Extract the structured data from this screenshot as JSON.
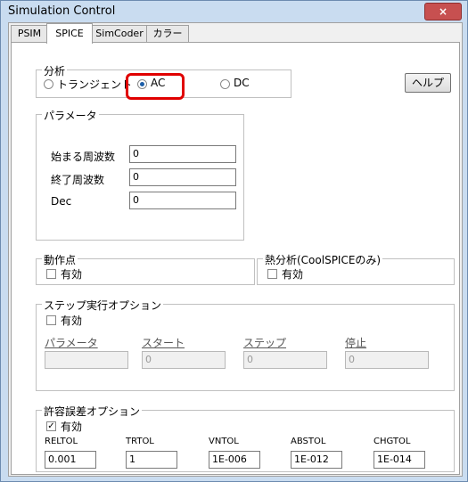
{
  "window": {
    "title": "Simulation Control",
    "close_glyph": "×"
  },
  "tabs": [
    "PSIM",
    "SPICE",
    "SimCoder",
    "カラー"
  ],
  "analysis": {
    "legend": "分析",
    "options": [
      "トランジェント",
      "AC",
      "DC"
    ],
    "selected": "AC",
    "help_label": "ヘルプ"
  },
  "params": {
    "legend": "パラメータ",
    "fields": [
      {
        "label": "始まる周波数",
        "value": "0"
      },
      {
        "label": "終了周波数",
        "value": "0"
      },
      {
        "label": "Dec",
        "value": "0"
      }
    ]
  },
  "operating_point": {
    "legend": "動作点",
    "checkbox_label": "有効",
    "checked": false
  },
  "thermal": {
    "legend": "熱分析(CoolSPICEのみ)",
    "checkbox_label": "有効",
    "checked": false
  },
  "step": {
    "legend": "ステップ実行オプション",
    "checkbox_label": "有効",
    "checked": false,
    "columns": [
      {
        "label": "パラメータ",
        "value": ""
      },
      {
        "label": "スタート",
        "value": "0"
      },
      {
        "label": "ステップ",
        "value": "0"
      },
      {
        "label": "停止",
        "value": "0"
      }
    ]
  },
  "tolerance": {
    "legend": "許容誤差オプション",
    "checkbox_label": "有効",
    "checked": true,
    "check_glyph": "✓",
    "columns": [
      {
        "label": "RELTOL",
        "value": "0.001"
      },
      {
        "label": "TRTOL",
        "value": "1"
      },
      {
        "label": "VNTOL",
        "value": "1E-006"
      },
      {
        "label": "ABSTOL",
        "value": "1E-012"
      },
      {
        "label": "CHGTOL",
        "value": "1E-014"
      }
    ]
  },
  "colors": {
    "highlight": "#e00000",
    "titlebar": "#c9dcf0",
    "close": "#c75050"
  }
}
